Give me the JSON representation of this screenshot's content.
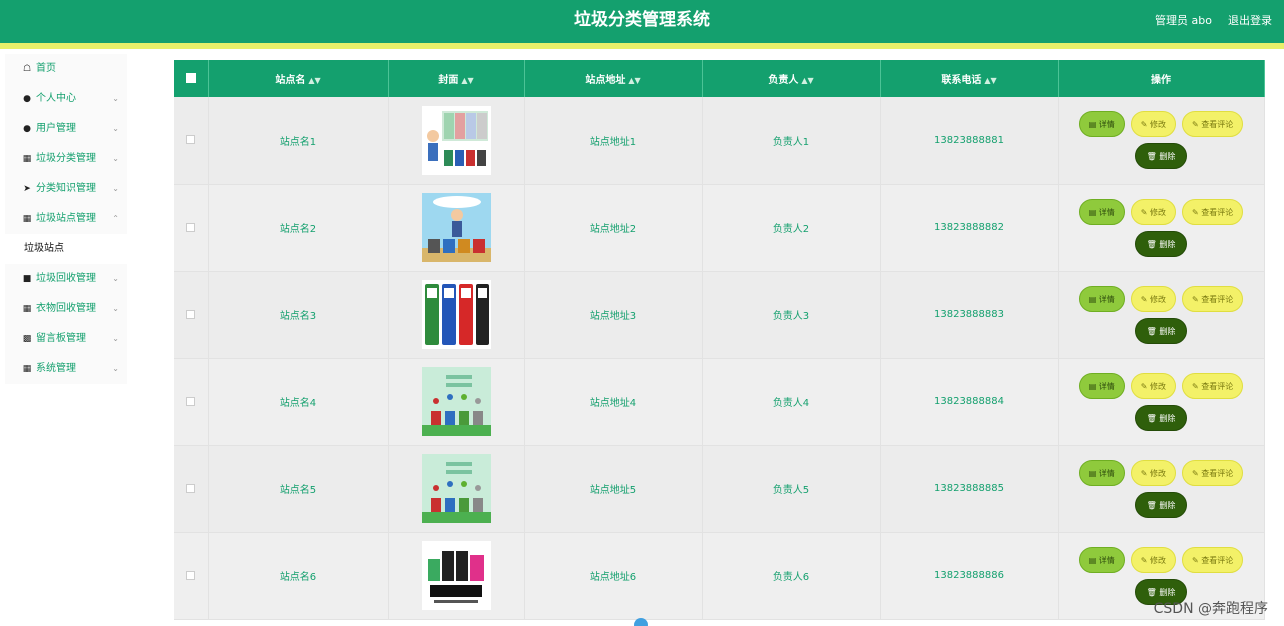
{
  "header": {
    "title": "垃圾分类管理系统",
    "user_label": "管理员 abo",
    "logout_label": "退出登录"
  },
  "colors": {
    "primary": "#14a06e",
    "accent_strip": "#e8f06a",
    "detail": "#8fca3c",
    "edit": "#f3f168",
    "delete": "#2f5f0b"
  },
  "sidebar": {
    "items": [
      {
        "label": "首页",
        "icon": "home-icon"
      },
      {
        "label": "个人中心",
        "icon": "user-icon"
      },
      {
        "label": "用户管理",
        "icon": "user-icon"
      },
      {
        "label": "垃圾分类管理",
        "icon": "grid-icon"
      },
      {
        "label": "分类知识管理",
        "icon": "send-icon"
      },
      {
        "label": "垃圾站点管理",
        "icon": "grid-icon"
      },
      {
        "label": "垃圾站点",
        "icon": ""
      },
      {
        "label": "垃圾回收管理",
        "icon": "briefcase-icon"
      },
      {
        "label": "衣物回收管理",
        "icon": "grid-icon"
      },
      {
        "label": "留言板管理",
        "icon": "bar-chart-icon"
      },
      {
        "label": "系统管理",
        "icon": "grid-icon"
      }
    ]
  },
  "table": {
    "headers": {
      "name": "站点名",
      "cover": "封面",
      "address": "站点地址",
      "manager": "负责人",
      "phone": "联系电话",
      "actions": "操作"
    },
    "buttons": {
      "detail": "详情",
      "edit": "修改",
      "review": "查看评论",
      "delete": "删除"
    },
    "rows": [
      {
        "name": "站点名1",
        "address": "站点地址1",
        "manager": "负责人1",
        "phone": "13823888881"
      },
      {
        "name": "站点名2",
        "address": "站点地址2",
        "manager": "负责人2",
        "phone": "13823888882"
      },
      {
        "name": "站点名3",
        "address": "站点地址3",
        "manager": "负责人3",
        "phone": "13823888883"
      },
      {
        "name": "站点名4",
        "address": "站点地址4",
        "manager": "负责人4",
        "phone": "13823888884"
      },
      {
        "name": "站点名5",
        "address": "站点地址5",
        "manager": "负责人5",
        "phone": "13823888885"
      },
      {
        "name": "站点名6",
        "address": "站点地址6",
        "manager": "负责人6",
        "phone": "13823888886"
      }
    ]
  },
  "watermark": "CSDN @奔跑程序"
}
